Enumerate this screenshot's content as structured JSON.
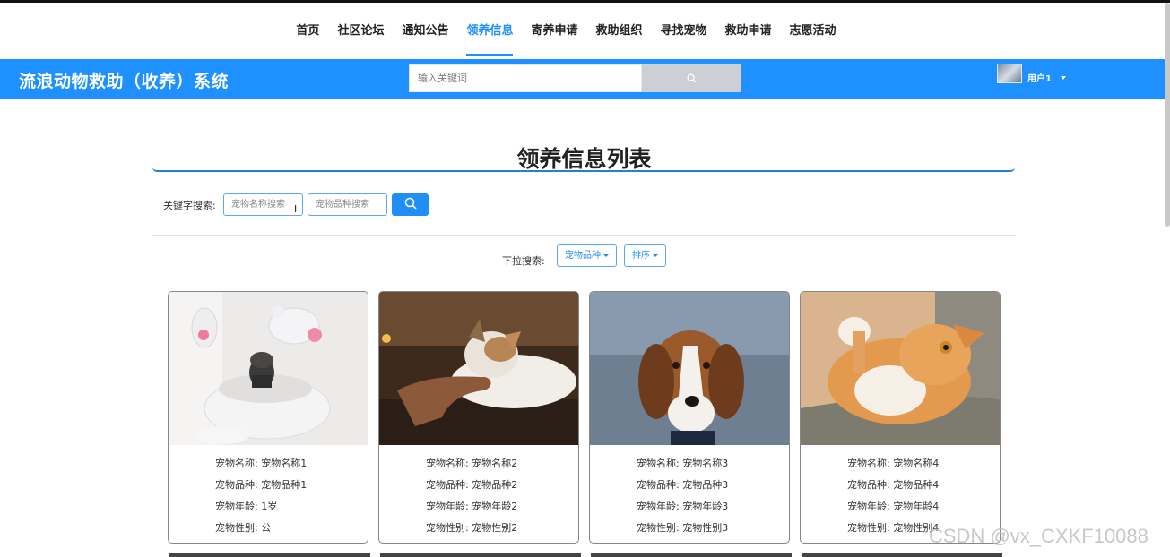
{
  "nav": {
    "items": [
      {
        "label": "首页",
        "active": false
      },
      {
        "label": "社区论坛",
        "active": false
      },
      {
        "label": "通知公告",
        "active": false
      },
      {
        "label": "领养信息",
        "active": true
      },
      {
        "label": "寄养申请",
        "active": false
      },
      {
        "label": "救助组织",
        "active": false
      },
      {
        "label": "寻找宠物",
        "active": false
      },
      {
        "label": "救助申请",
        "active": false
      },
      {
        "label": "志愿活动",
        "active": false
      }
    ]
  },
  "header": {
    "brand": "流浪动物救助（收养）系统",
    "search_placeholder": "输入关键词",
    "search_icon": "search-icon",
    "username": "用户1",
    "accent": "#1e90ff"
  },
  "main": {
    "title": "领养信息列表",
    "keyword_label": "关键字搜索:",
    "name_placeholder": "宠物名称搜索",
    "breed_placeholder": "宠物品种搜索",
    "dropdown_label": "下拉搜索:",
    "breed_dropdown": "宠物品种",
    "sort_dropdown": "排序"
  },
  "cards": [
    {
      "name_label": "宠物名称:",
      "name": "宠物名称1",
      "breed_label": "宠物品种:",
      "breed": "宠物品种1",
      "age_label": "宠物年龄:",
      "age": "1岁",
      "sex_label": "宠物性别:",
      "sex": "公"
    },
    {
      "name_label": "宠物名称:",
      "name": "宠物名称2",
      "breed_label": "宠物品种:",
      "breed": "宠物品种2",
      "age_label": "宠物年龄:",
      "age": "宠物年龄2",
      "sex_label": "宠物性别:",
      "sex": "宠物性别2"
    },
    {
      "name_label": "宠物名称:",
      "name": "宠物名称3",
      "breed_label": "宠物品种:",
      "breed": "宠物品种3",
      "age_label": "宠物年龄:",
      "age": "宠物年龄3",
      "sex_label": "宠物性别:",
      "sex": "宠物性别3"
    },
    {
      "name_label": "宠物名称:",
      "name": "宠物名称4",
      "breed_label": "宠物品种:",
      "breed": "宠物品种4",
      "age_label": "宠物年龄:",
      "age": "宠物年龄4",
      "sex_label": "宠物性别:",
      "sex": "宠物性别4"
    }
  ],
  "watermark": "CSDN @vx_CXKF10088"
}
